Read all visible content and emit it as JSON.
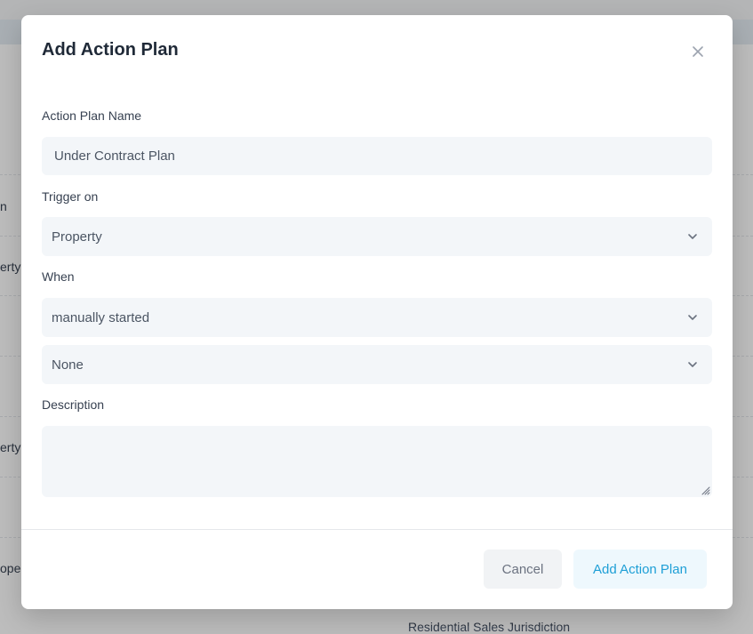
{
  "background": {
    "fragments": [
      "n",
      "erty",
      "erty",
      "ope",
      "Residential Sales Jurisdiction"
    ]
  },
  "modal": {
    "title": "Add Action Plan",
    "fields": {
      "name": {
        "label": "Action Plan Name",
        "value": "Under Contract Plan"
      },
      "trigger": {
        "label": "Trigger on",
        "value": "Property"
      },
      "when": {
        "label": "When",
        "value": "manually started"
      },
      "when_detail": {
        "value": "None"
      },
      "description": {
        "label": "Description",
        "value": ""
      }
    },
    "buttons": {
      "cancel": "Cancel",
      "submit": "Add Action Plan"
    },
    "icons": {
      "close": "close-icon",
      "dropdown": "chevron-down-icon",
      "resize": "resize-grip-icon"
    },
    "colors": {
      "primary_text": "#1e9fd6",
      "primary_bg": "#eef8fd",
      "field_bg": "#f3f6f9"
    }
  }
}
